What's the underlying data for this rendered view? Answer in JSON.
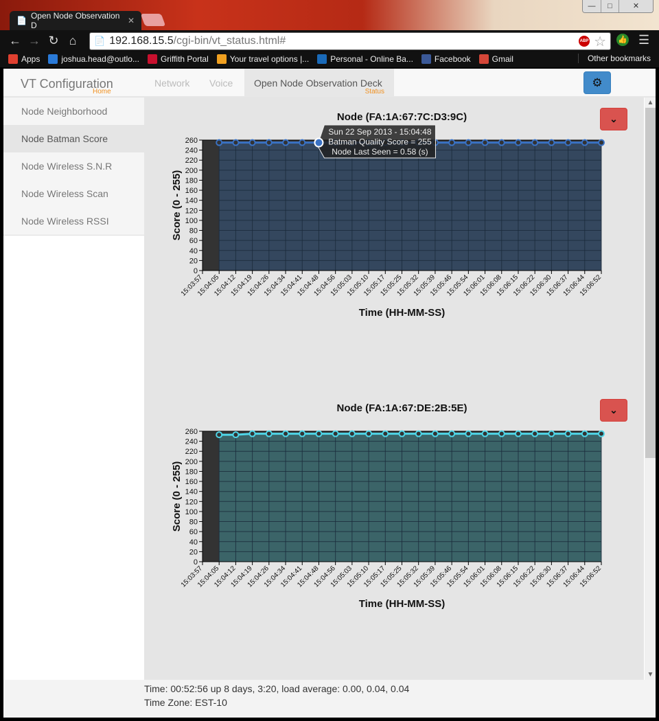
{
  "browser": {
    "tab_title": "Open Node Observation D",
    "url_host": "192.168.15.5",
    "url_path": "/cgi-bin/vt_status.html#",
    "bookmarks": [
      {
        "label": "Apps",
        "color": "#e04030"
      },
      {
        "label": "joshua.head@outlo...",
        "color": "#2a7ad8"
      },
      {
        "label": "Griffith Portal",
        "color": "#c8102e"
      },
      {
        "label": "Your travel options |...",
        "color": "#f0a020"
      },
      {
        "label": "Personal - Online Ba...",
        "color": "#1a6ab8"
      },
      {
        "label": "Facebook",
        "color": "#3b5998"
      },
      {
        "label": "Gmail",
        "color": "#d44638"
      }
    ],
    "other_bookmarks": "Other bookmarks"
  },
  "navbar": {
    "brand": "VT Configuration",
    "brand_sub": "Home",
    "items": [
      {
        "label": "Network"
      },
      {
        "label": "Voice"
      },
      {
        "label": "Open Node Observation Deck",
        "sub": "Status"
      }
    ]
  },
  "sidebar": {
    "items": [
      {
        "label": "Node Neighborhood"
      },
      {
        "label": "Node Batman Score"
      },
      {
        "label": "Node Wireless S.N.R"
      },
      {
        "label": "Node Wireless Scan"
      },
      {
        "label": "Node Wireless RSSI"
      }
    ]
  },
  "tooltip": {
    "line1": "Sun 22 Sep 2013 - 15:04:48",
    "line2": "Batman Quality Score = 255",
    "line3": "Node Last Seen = 0.58 (s)"
  },
  "footer": {
    "line1": "Time: 00:52:56 up 8 days, 3:20, load average: 0.00, 0.04, 0.04",
    "line2": "Time Zone: EST-10"
  },
  "chart_data": [
    {
      "type": "area",
      "title": "Node (FA:1A:67:7C:D3:9C)",
      "xlabel": "Time (HH-MM-SS)",
      "ylabel": "Score (0 - 255)",
      "ylim": [
        0,
        260
      ],
      "yticks": [
        0,
        20,
        40,
        60,
        80,
        100,
        120,
        140,
        160,
        180,
        200,
        220,
        240,
        260
      ],
      "categories": [
        "15:03:57",
        "15:04:05",
        "15:04:12",
        "15:04:19",
        "15:04:26",
        "15:04:34",
        "15:04:41",
        "15:04:48",
        "15:04:56",
        "15:05:03",
        "15:05:10",
        "15:05:17",
        "15:05:25",
        "15:05:32",
        "15:05:39",
        "15:05:46",
        "15:05:54",
        "15:06:01",
        "15:06:08",
        "15:06:15",
        "15:06:22",
        "15:06:30",
        "15:06:37",
        "15:06:44",
        "15:06:52"
      ],
      "series": [
        {
          "name": "Batman Quality Score",
          "start_index": 1,
          "values": [
            255,
            255,
            255,
            255,
            255,
            255,
            255,
            255,
            255,
            255,
            255,
            255,
            255,
            255,
            255,
            255,
            255,
            255,
            255,
            255,
            255,
            255,
            255,
            255
          ]
        }
      ],
      "line_color": "#3a72c4",
      "fill_color": "#34475e",
      "highlight_index": 7,
      "grid": true
    },
    {
      "type": "area",
      "title": "Node (FA:1A:67:DE:2B:5E)",
      "xlabel": "Time (HH-MM-SS)",
      "ylabel": "Score (0 - 255)",
      "ylim": [
        0,
        260
      ],
      "yticks": [
        0,
        20,
        40,
        60,
        80,
        100,
        120,
        140,
        160,
        180,
        200,
        220,
        240,
        260
      ],
      "categories": [
        "15:03:57",
        "15:04:05",
        "15:04:12",
        "15:04:19",
        "15:04:26",
        "15:04:34",
        "15:04:41",
        "15:04:48",
        "15:04:56",
        "15:05:03",
        "15:05:10",
        "15:05:17",
        "15:05:25",
        "15:05:32",
        "15:05:39",
        "15:05:46",
        "15:05:54",
        "15:06:01",
        "15:06:08",
        "15:06:15",
        "15:06:22",
        "15:06:30",
        "15:06:37",
        "15:06:44",
        "15:06:52"
      ],
      "series": [
        {
          "name": "Batman Quality Score",
          "start_index": 1,
          "values": [
            253,
            253,
            255,
            255,
            255,
            255,
            255,
            255,
            255,
            255,
            255,
            255,
            255,
            255,
            255,
            255,
            255,
            255,
            255,
            255,
            255,
            255,
            255,
            255
          ]
        }
      ],
      "line_color": "#4fd6e8",
      "fill_color": "#3b6468",
      "highlight_index": -1,
      "grid": true
    }
  ]
}
